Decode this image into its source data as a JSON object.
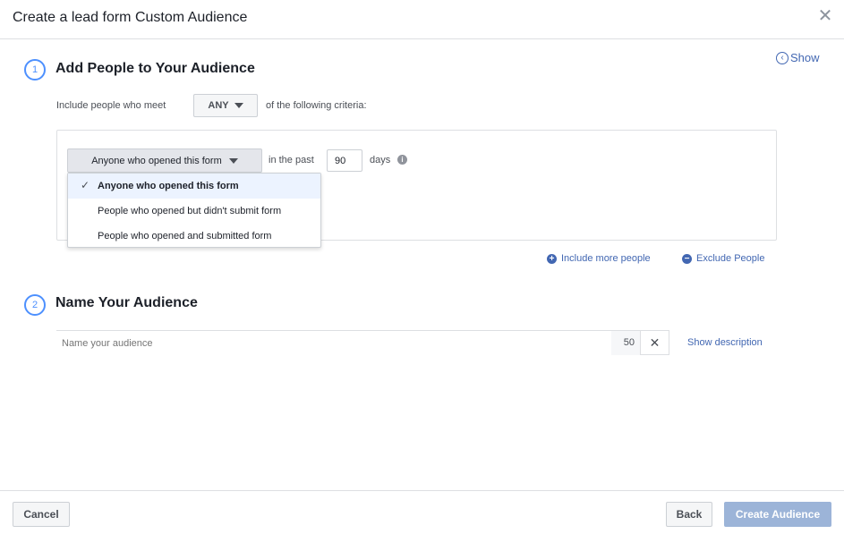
{
  "header": {
    "title": "Create a lead form Custom Audience",
    "close_glyph": "✕"
  },
  "show_toggle": {
    "label": "Show",
    "icon_glyph": "‹"
  },
  "step1": {
    "number": "1",
    "title": "Add People to Your Audience",
    "criteria_prefix": "Include people who meet",
    "match_value": "ANY",
    "criteria_suffix": "of the following criteria:",
    "rule": {
      "selected": "Anyone who opened this form",
      "in_the_past_label": "in the past",
      "days_value": "90",
      "days_label": "days",
      "info_glyph": "i"
    },
    "dropdown_options": [
      {
        "label": "Anyone who opened this form",
        "selected": true,
        "check_glyph": "✓"
      },
      {
        "label": "People who opened but didn't submit form",
        "selected": false
      },
      {
        "label": "People who opened and submitted form",
        "selected": false
      }
    ],
    "include_more": {
      "label": "Include more people",
      "icon_glyph": "+"
    },
    "exclude": {
      "label": "Exclude People",
      "icon_glyph": "−"
    }
  },
  "step2": {
    "number": "2",
    "title": "Name Your Audience",
    "name_placeholder": "Name your audience",
    "char_remaining": "50",
    "clear_glyph": "✕",
    "show_description": "Show description"
  },
  "footer": {
    "cancel": "Cancel",
    "back": "Back",
    "create": "Create Audience"
  },
  "colors": {
    "accent": "#4267b2",
    "step_circle": "#4d90fe",
    "primary_disabled": "#9cb4d8",
    "selected_row": "#ecf3ff"
  }
}
